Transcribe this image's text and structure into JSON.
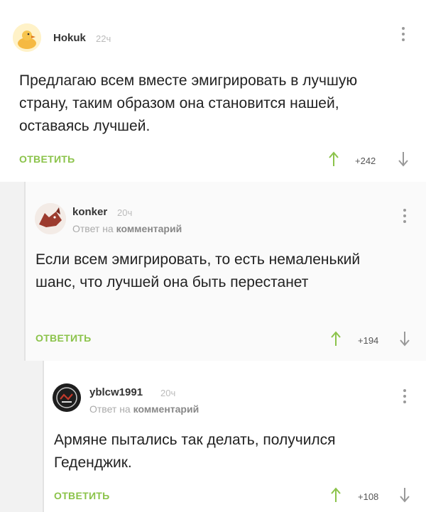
{
  "comments": [
    {
      "author": "Hokuk",
      "time": "22ч",
      "reply_to": null,
      "text": "Предлагаю всем вместе эмигрировать в лучшую страну, таким образом она становится нашей, оставаясь лучшей.",
      "reply_label": "ОТВЕТИТЬ",
      "rating": "+242"
    },
    {
      "author": "konker",
      "time": "20ч",
      "reply_to_prefix": "Ответ на",
      "reply_to_target": "комментарий",
      "text": "Если всем эмигрировать, то есть немаленький шанс, что лучшей она быть перестанет",
      "reply_label": "ОТВЕТИТЬ",
      "rating": "+194"
    },
    {
      "author": "yblcw1991",
      "time": "20ч",
      "reply_to_prefix": "Ответ на",
      "reply_to_target": "комментарий",
      "text": "Армяне пытались так делать, получился Геденджик.",
      "reply_label": "ОТВЕТИТЬ",
      "rating": "+108"
    }
  ],
  "colors": {
    "accent_green": "#8bc34a",
    "background": "#f2f2f2"
  },
  "icons": [
    "avatar-duck",
    "avatar-wolf",
    "avatar-logo",
    "kebab-menu-icon",
    "arrow-up-icon",
    "arrow-down-icon"
  ]
}
